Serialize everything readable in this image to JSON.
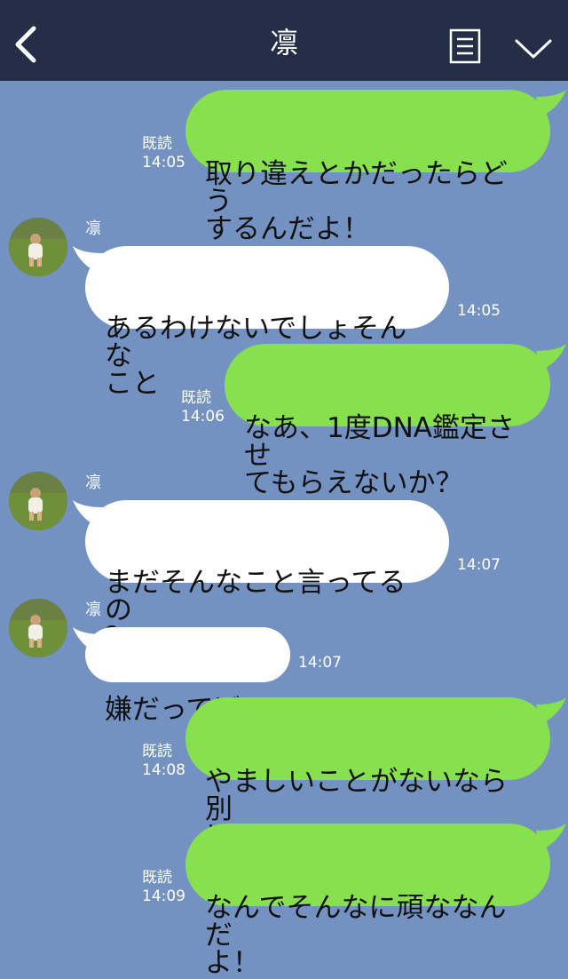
{
  "header": {
    "title": "凛",
    "back_icon": "chevron-left-icon",
    "menu_icon": "document-menu-icon",
    "dropdown_icon": "chevron-down-icon",
    "background": "#242f47"
  },
  "colors": {
    "chat_background": "#7392c2",
    "sent_bubble": "#87e04d",
    "received_bubble": "#ffffff"
  },
  "messages": [
    {
      "direction": "sent",
      "text": "取り違えとかだったらどう\nするんだよ！",
      "read": "既読",
      "time": "14:05"
    },
    {
      "direction": "received",
      "sender": "凛",
      "text": "あるわけないでしょそんな\nこと",
      "time": "14:05"
    },
    {
      "direction": "sent",
      "text": "なあ、1度DNA鑑定させ\nてもらえないか？",
      "read": "既読",
      "time": "14:06"
    },
    {
      "direction": "received",
      "sender": "凛",
      "text": "まだそんなこと言ってるの\n？",
      "time": "14:07"
    },
    {
      "direction": "received",
      "sender": "凛",
      "text": "嫌だってば！",
      "time": "14:07"
    },
    {
      "direction": "sent",
      "text": "やましいことがないなら別\nにいいだろ！",
      "read": "既読",
      "time": "14:08"
    },
    {
      "direction": "sent",
      "text": "なんでそんなに頑ななんだ\nよ！",
      "read": "既読",
      "time": "14:09"
    }
  ]
}
